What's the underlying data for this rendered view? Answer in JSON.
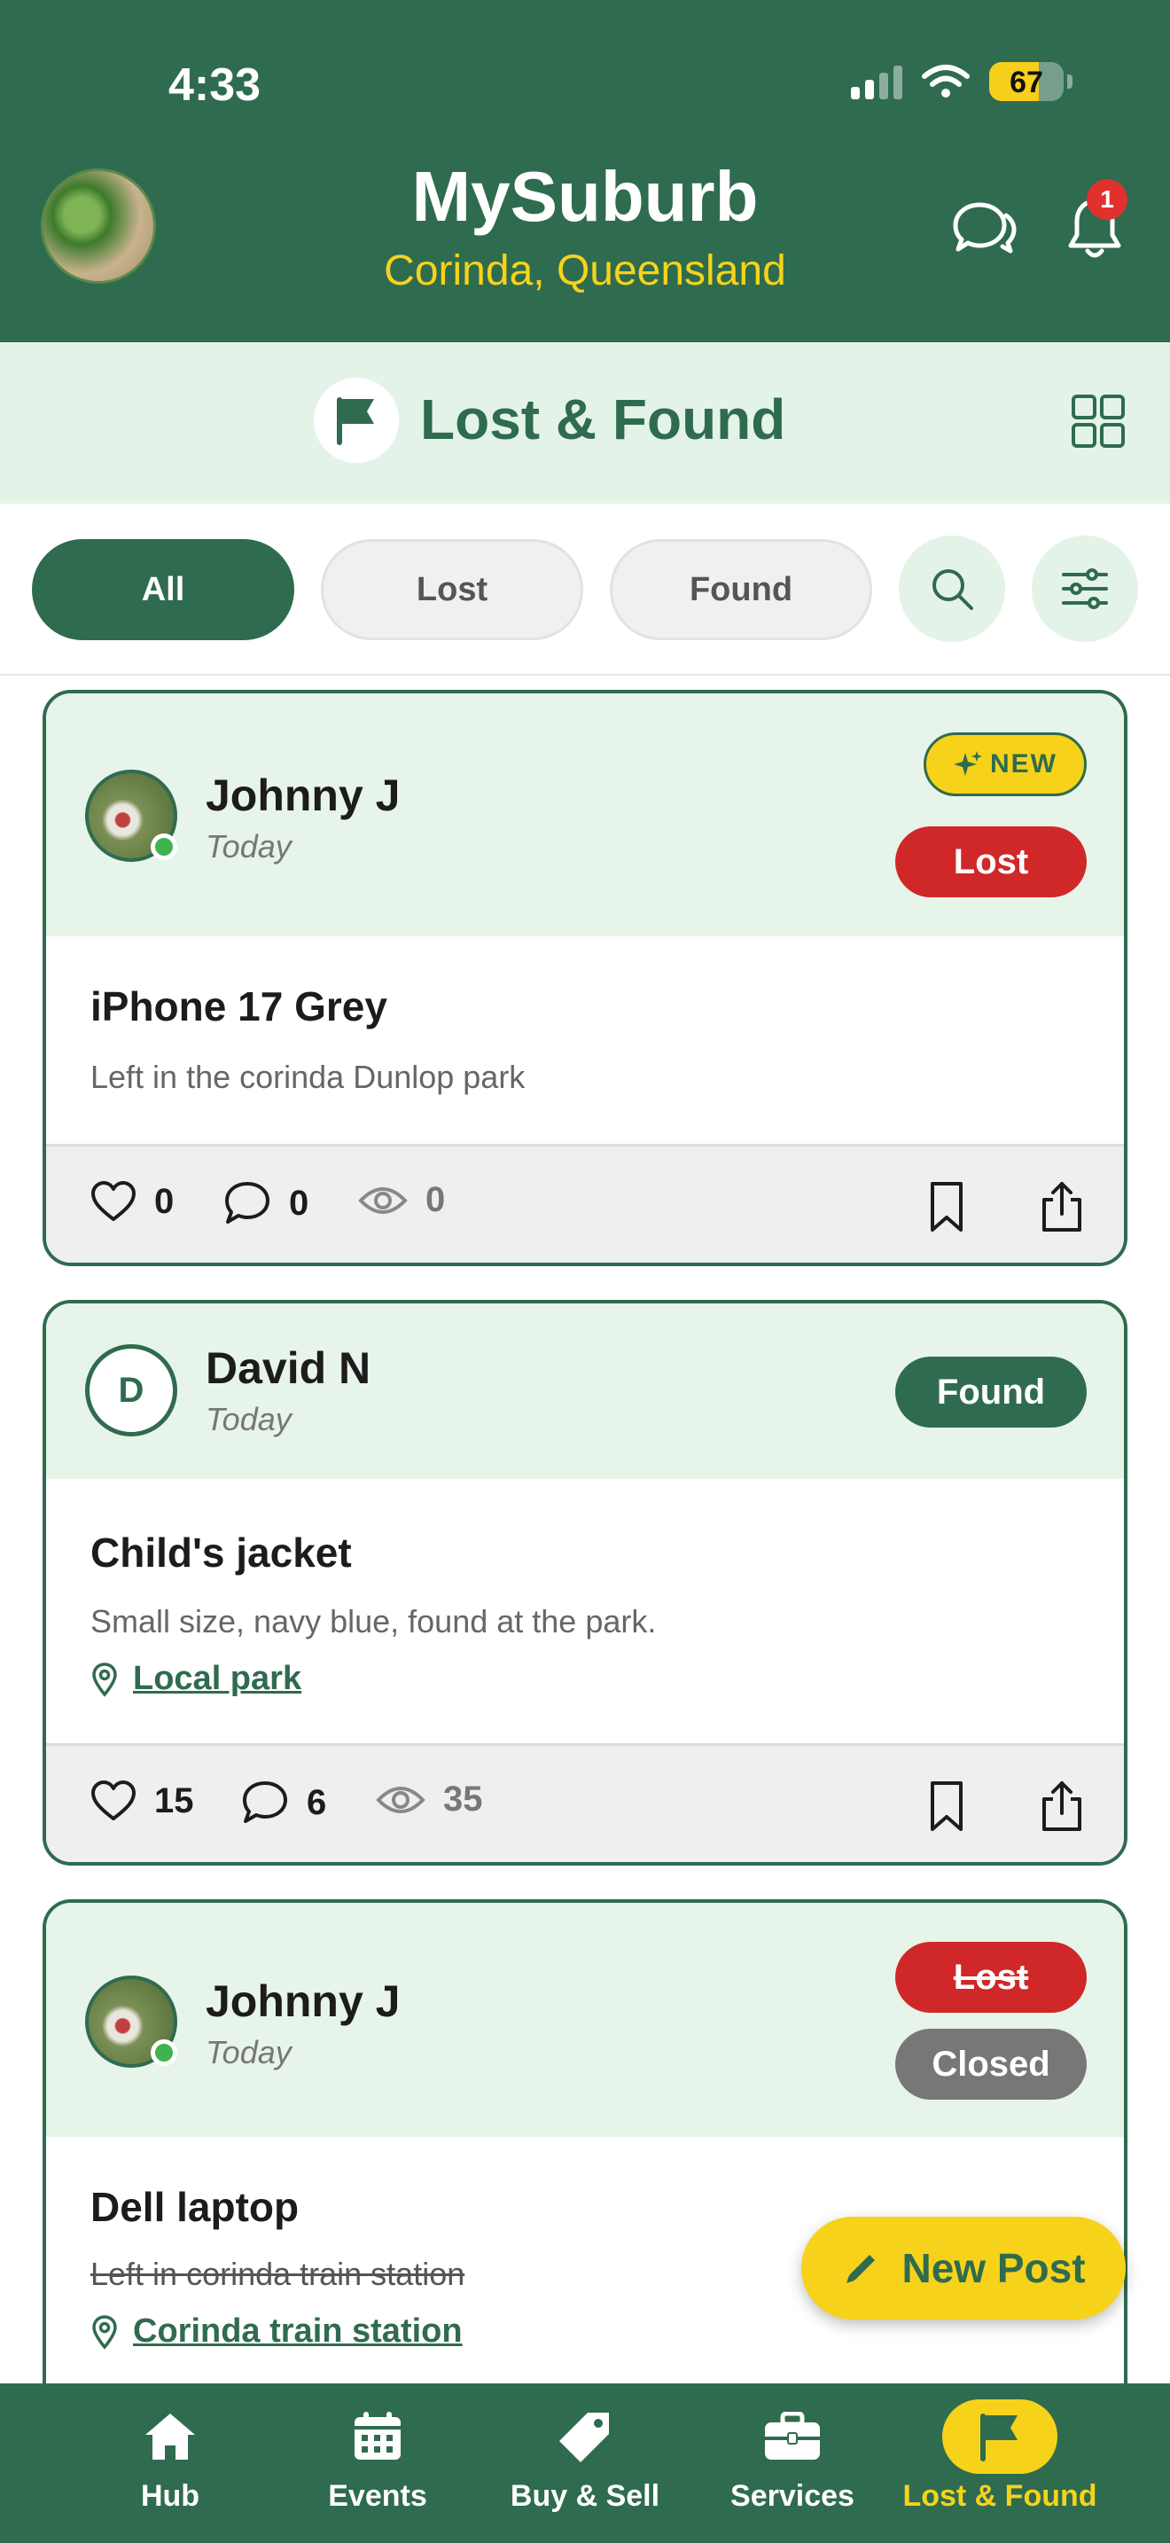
{
  "status_bar": {
    "time": "4:33",
    "battery": 67
  },
  "header": {
    "title": "MySuburb",
    "subtitle": "Corinda, Queensland",
    "notification_count": "1"
  },
  "section": {
    "title": "Lost & Found"
  },
  "filters": {
    "items": [
      "All",
      "Lost",
      "Found"
    ],
    "active": "All"
  },
  "posts": [
    {
      "author": "Johnny J",
      "time": "Today",
      "new_badge": "NEW",
      "status": "Lost",
      "title": "iPhone 17 Grey",
      "description": "Left in the corinda Dunlop park",
      "likes": "0",
      "comments": "0",
      "views": "0"
    },
    {
      "author": "David N",
      "initial": "D",
      "time": "Today",
      "status": "Found",
      "title": "Child's jacket",
      "description": "Small size, navy blue, found at the park.",
      "location": "Local park",
      "likes": "15",
      "comments": "6",
      "views": "35"
    },
    {
      "author": "Johnny J",
      "time": "Today",
      "status": "Lost",
      "closed_label": "Closed",
      "title": "Dell laptop",
      "description": "Left in corinda train station",
      "location": "Corinda train station"
    }
  ],
  "fab": {
    "label": "New Post"
  },
  "nav": {
    "items": [
      "Hub",
      "Events",
      "Buy & Sell",
      "Services",
      "Lost & Found"
    ],
    "active": "Lost & Found"
  },
  "colors": {
    "primary": "#2f6b4f",
    "accent": "#f6d31a",
    "lost": "#d02828",
    "light": "#e4f3e8"
  }
}
